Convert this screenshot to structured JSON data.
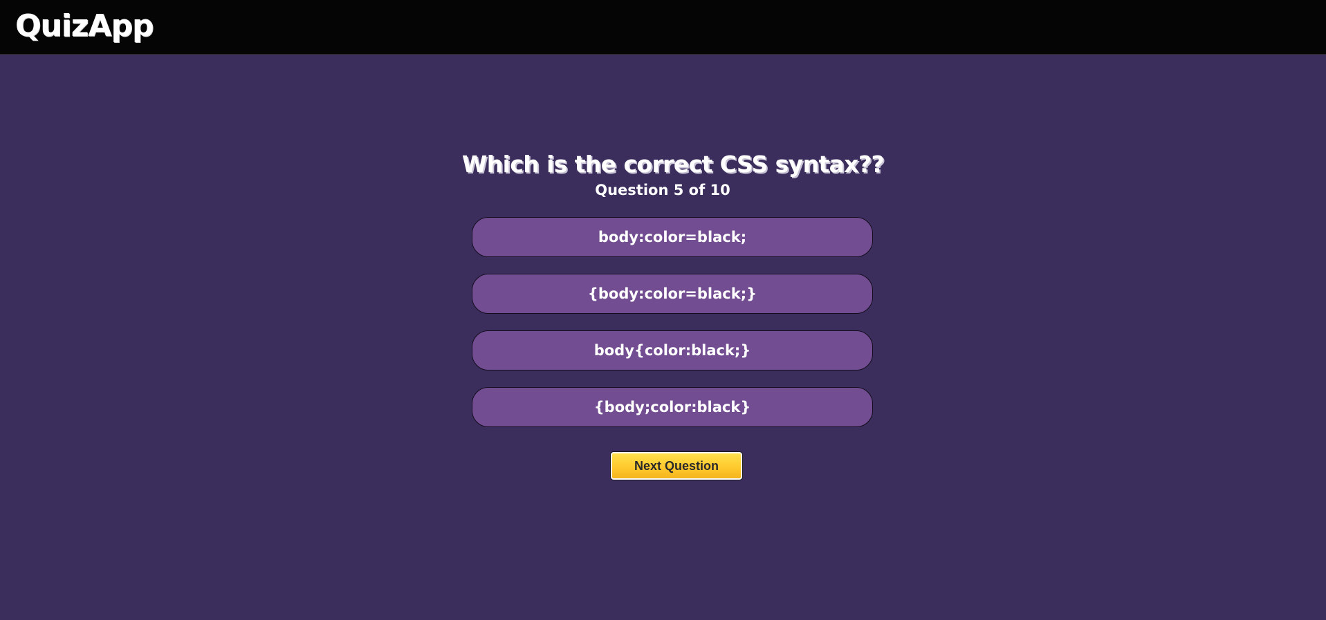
{
  "app": {
    "brand": "QuizApp"
  },
  "quiz": {
    "question": "Which is the correct CSS syntax??",
    "counter": "Question 5 of 10",
    "options": [
      "body:color=black;",
      "{body:color=black;}",
      "body{color:black;}",
      "{body;color:black}"
    ],
    "next_label": "Next Question"
  },
  "colors": {
    "page_background": "#3c2e5c",
    "navbar_background": "#050505",
    "option_background": "#734d92",
    "next_button": "#ffca2e"
  }
}
